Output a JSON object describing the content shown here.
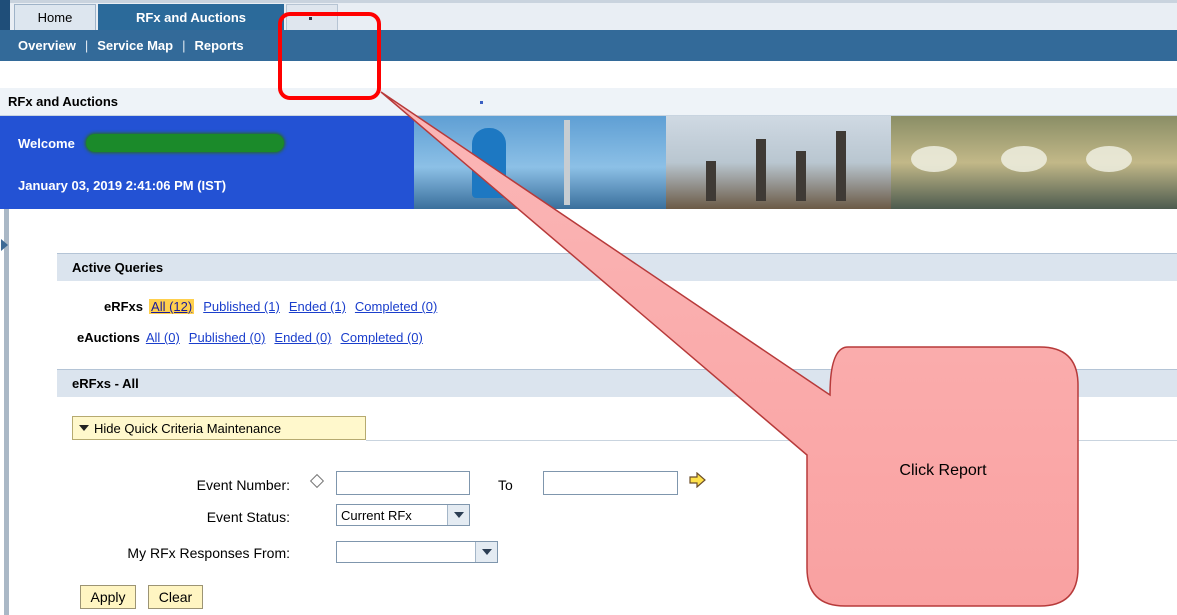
{
  "tabs": {
    "home": "Home",
    "rfx": "RFx and Auctions"
  },
  "subnav": {
    "overview": "Overview",
    "sep1": "|",
    "service_map": "Service Map",
    "sep2": "|",
    "reports": "Reports"
  },
  "page_title": "RFx and Auctions",
  "welcome": {
    "greeting": "Welcome",
    "datetime": "January 03, 2019  2:41:06 PM (IST)"
  },
  "active_queries": {
    "title": "Active Queries",
    "erfxs": {
      "label": "eRFxs",
      "links": [
        "All (12)",
        "Published (1)",
        "Ended (1)",
        "Completed (0)"
      ]
    },
    "eauctions": {
      "label": "eAuctions",
      "links": [
        "All (0)",
        "Published (0)",
        "Ended (0)",
        "Completed (0)"
      ]
    }
  },
  "list": {
    "title": "eRFxs - All",
    "toggle_label": "Hide Quick Criteria Maintenance"
  },
  "form": {
    "event_number_label": "Event Number:",
    "to_label": "To",
    "event_status_label": "Event Status:",
    "event_status_value": "Current RFx",
    "responses_label": "My RFx Responses From:",
    "responses_value": ""
  },
  "buttons": {
    "apply": "Apply",
    "clear": "Clear"
  },
  "callout": {
    "text": "Click Report"
  },
  "colors": {
    "nav_blue": "#336a99",
    "welcome_blue": "#2352d4",
    "highlight_red": "#ff0000",
    "active_filter": "#ffd04d"
  }
}
